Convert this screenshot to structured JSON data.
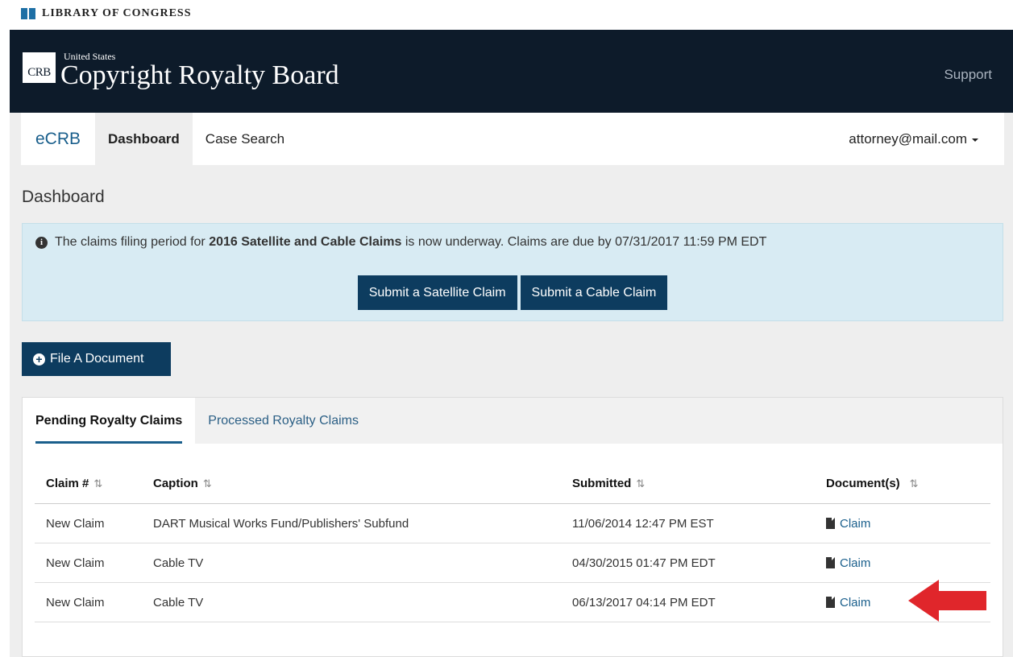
{
  "loc_banner": {
    "label": "LIBRARY OF CONGRESS"
  },
  "header": {
    "logo_text": "CRB",
    "subtitle": "United States",
    "title": "Copyright Royalty Board",
    "support_link": "Support"
  },
  "nav": {
    "brand": "eCRB",
    "items": [
      {
        "label": "Dashboard",
        "active": true
      },
      {
        "label": "Case Search",
        "active": false
      }
    ],
    "user": "attorney@mail.com"
  },
  "page": {
    "title": "Dashboard"
  },
  "alert": {
    "text_before": "The claims filing period for ",
    "text_bold": "2016 Satellite and Cable Claims",
    "text_after": " is now underway. Claims are due by 07/31/2017 11:59 PM EDT",
    "buttons": [
      "Submit a Satellite Claim",
      "Submit a Cable Claim"
    ]
  },
  "file_button": {
    "label": "File A Document"
  },
  "tabs": [
    {
      "label": "Pending Royalty Claims",
      "active": true
    },
    {
      "label": "Processed Royalty Claims",
      "active": false
    }
  ],
  "table": {
    "headers": [
      "Claim #",
      "Caption",
      "Submitted",
      "Document(s)"
    ],
    "rows": [
      {
        "claim": "New Claim",
        "caption": "DART Musical Works Fund/Publishers' Subfund",
        "submitted": "11/06/2014 12:47 PM EST",
        "document": "Claim"
      },
      {
        "claim": "New Claim",
        "caption": "Cable TV",
        "submitted": "04/30/2015 01:47 PM EDT",
        "document": "Claim"
      },
      {
        "claim": "New Claim",
        "caption": "Cable TV",
        "submitted": "06/13/2017 04:14 PM EDT",
        "document": "Claim"
      }
    ]
  },
  "colors": {
    "header_bg": "#0d1b2a",
    "button_bg": "#0d3c5f",
    "alert_bg": "#d8ebf3",
    "link": "#1a5f8c",
    "arrow": "#e0262b"
  }
}
